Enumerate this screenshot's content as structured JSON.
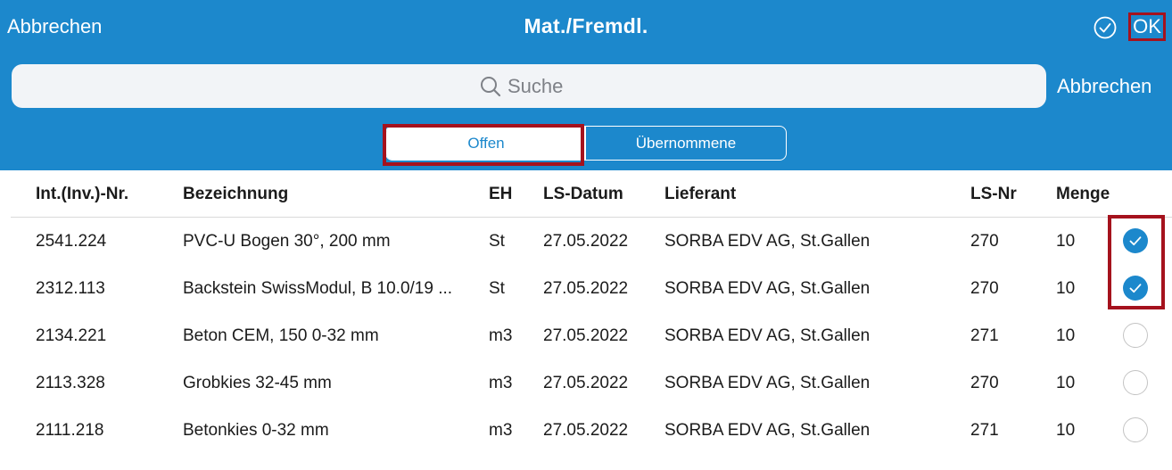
{
  "header": {
    "cancel_label": "Abbrechen",
    "title": "Mat./Fremdl.",
    "ok_label": "OK"
  },
  "search": {
    "placeholder": "Suche",
    "cancel_label": "Abbrechen"
  },
  "tabs": [
    {
      "label": "Offen",
      "active": true
    },
    {
      "label": "Übernommene",
      "active": false
    }
  ],
  "table": {
    "columns": [
      "Int.(Inv.)-Nr.",
      "Bezeichnung",
      "EH",
      "LS-Datum",
      "Lieferant",
      "LS-Nr",
      "Menge"
    ],
    "rows": [
      {
        "nr": "2541.224",
        "bezeichnung": "PVC-U Bogen 30°, 200 mm",
        "eh": "St",
        "datum": "27.05.2022",
        "lieferant": "SORBA EDV AG, St.Gallen",
        "lsnr": "270",
        "menge": "10",
        "selected": true
      },
      {
        "nr": "2312.113",
        "bezeichnung": "Backstein SwissModul, B 10.0/19 ...",
        "eh": "St",
        "datum": "27.05.2022",
        "lieferant": "SORBA EDV AG, St.Gallen",
        "lsnr": "270",
        "menge": "10",
        "selected": true
      },
      {
        "nr": "2134.221",
        "bezeichnung": "Beton CEM, 150 0-32 mm",
        "eh": "m3",
        "datum": "27.05.2022",
        "lieferant": "SORBA EDV AG, St.Gallen",
        "lsnr": "271",
        "menge": "10",
        "selected": false
      },
      {
        "nr": "2113.328",
        "bezeichnung": "Grobkies 32-45 mm",
        "eh": "m3",
        "datum": "27.05.2022",
        "lieferant": "SORBA EDV AG, St.Gallen",
        "lsnr": "270",
        "menge": "10",
        "selected": false
      },
      {
        "nr": "2111.218",
        "bezeichnung": "Betonkies 0-32 mm",
        "eh": "m3",
        "datum": "27.05.2022",
        "lieferant": "SORBA EDV AG, St.Gallen",
        "lsnr": "271",
        "menge": "10",
        "selected": false
      }
    ]
  },
  "colors": {
    "accent": "#1c88cc",
    "highlight": "#a5121d"
  }
}
